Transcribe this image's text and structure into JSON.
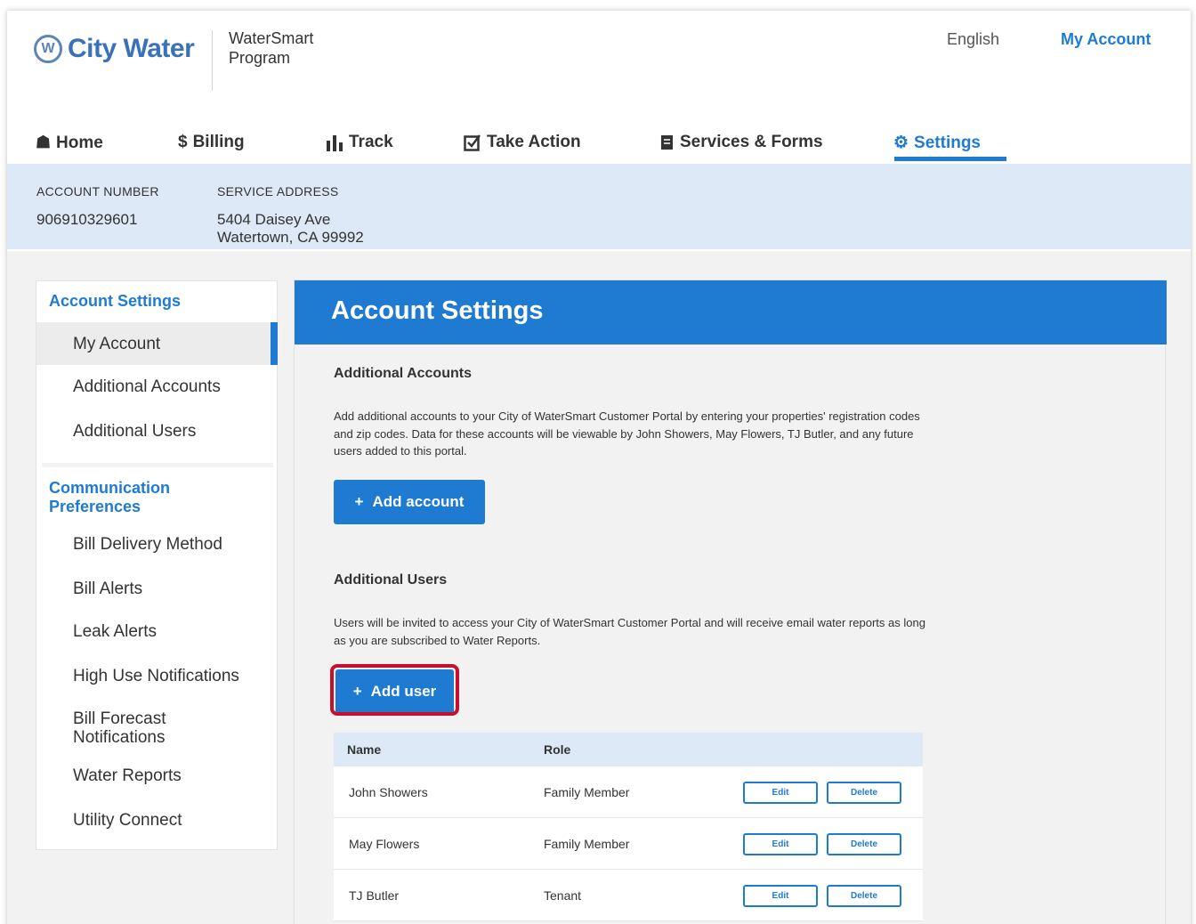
{
  "header": {
    "logo_text": "City Water",
    "program_line1": "WaterSmart",
    "program_line2": "Program",
    "language": "English",
    "my_account": "My Account"
  },
  "nav": {
    "home": "Home",
    "billing": "Billing",
    "track": "Track",
    "take_action": "Take Action",
    "services_forms": "Services & Forms",
    "settings": "Settings"
  },
  "account": {
    "number_label": "ACCOUNT NUMBER",
    "number": "906910329601",
    "address_label": "SERVICE ADDRESS",
    "address_line1": "5404 Daisey Ave",
    "address_line2": "Watertown, CA 99992"
  },
  "sidebar": {
    "account_settings_head": "Account Settings",
    "my_account": "My Account",
    "additional_accounts": "Additional Accounts",
    "additional_users": "Additional Users",
    "comm_head_line1": "Communication",
    "comm_head_line2": "Preferences",
    "bill_delivery": "Bill Delivery Method",
    "bill_alerts": "Bill Alerts",
    "leak_alerts": "Leak Alerts",
    "high_use": "High Use Notifications",
    "bill_forecast_line1": "Bill Forecast",
    "bill_forecast_line2": "Notifications",
    "water_reports": "Water Reports",
    "utility_connect": "Utility Connect"
  },
  "main": {
    "title": "Account Settings",
    "accounts_title": "Additional Accounts",
    "accounts_desc": "Add additional accounts to your City of WaterSmart Customer Portal by entering your properties' registration codes and zip codes. Data for these accounts will be viewable by John Showers, May Flowers, TJ Butler, and any future users added to this portal.",
    "add_account": "Add account",
    "users_title": "Additional Users",
    "users_desc": "Users will be invited to access your City of WaterSmart Customer Portal and will receive email water reports as long as you are subscribed to Water Reports.",
    "add_user": "Add user"
  },
  "table": {
    "col_name": "Name",
    "col_role": "Role",
    "edit": "Edit",
    "delete": "Delete",
    "rows": [
      {
        "name": "John Showers",
        "role": "Family Member"
      },
      {
        "name": "May Flowers",
        "role": "Family Member"
      },
      {
        "name": "TJ Butler",
        "role": "Tenant"
      }
    ]
  },
  "colors": {
    "accent": "#1f7bd1",
    "band": "#dde9f6",
    "highlight": "#c8102e"
  }
}
